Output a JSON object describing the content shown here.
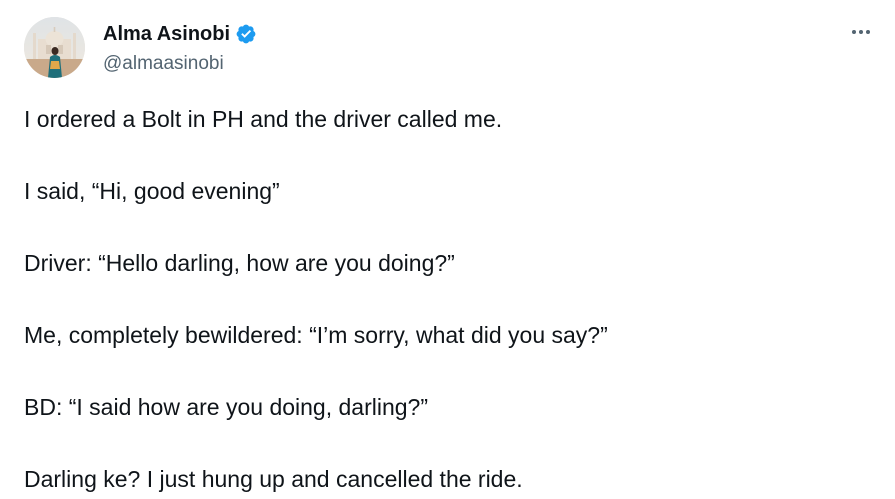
{
  "author": {
    "display_name": "Alma Asinobi",
    "handle": "@almaasinobi",
    "verified": true,
    "verified_color": "#1d9bf0"
  },
  "more_icon": "more-horizontal-icon",
  "tweet": {
    "lines": [
      "I ordered a Bolt in PH and the driver called me.",
      "I said, “Hi, good evening”",
      "Driver: “Hello darling, how are you doing?”",
      "Me, completely bewildered: “I’m sorry, what did you say?”",
      "BD: “I said how are you doing, darling?”",
      "Darling ke? I just hung up and cancelled the ride."
    ]
  }
}
